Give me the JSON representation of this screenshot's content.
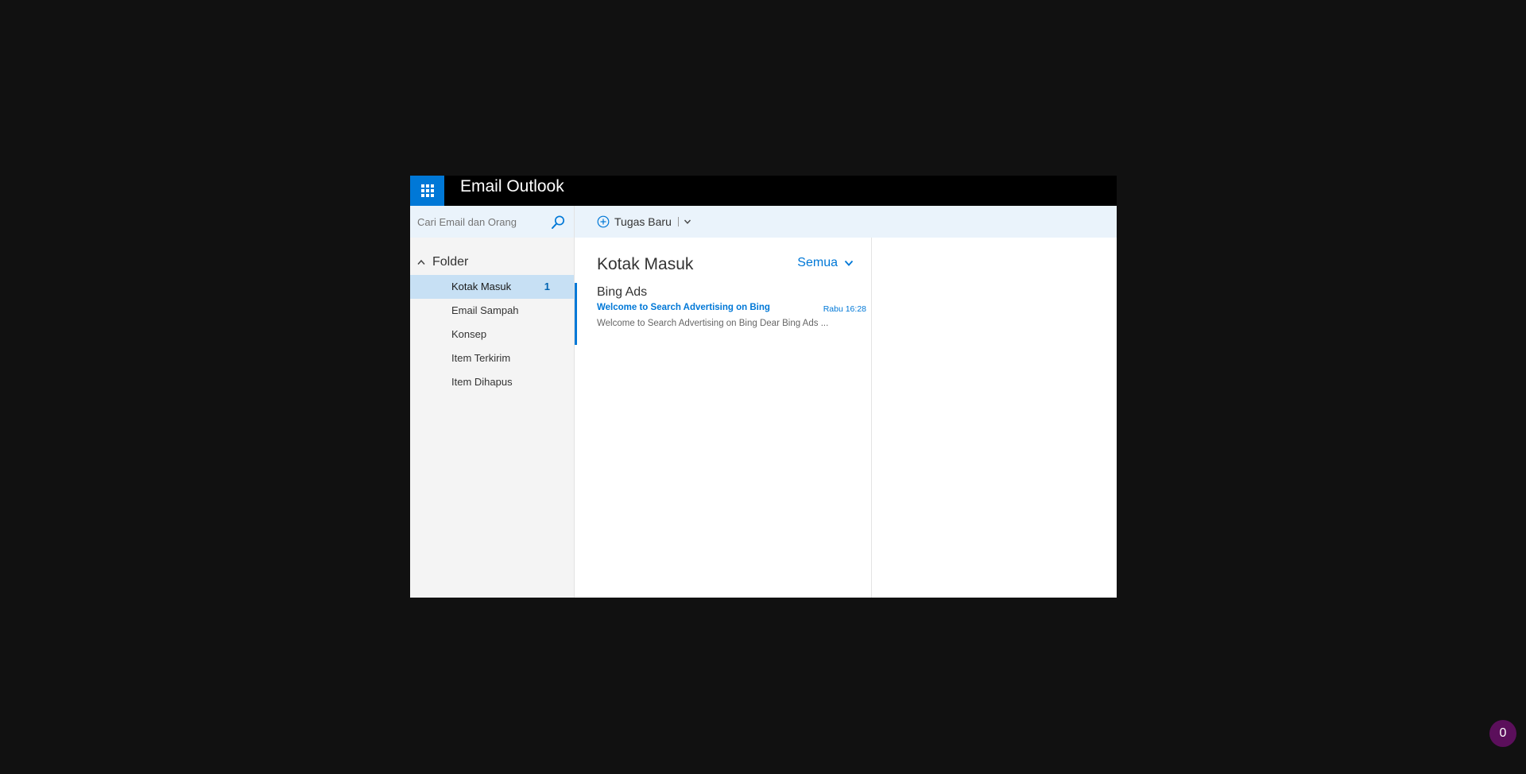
{
  "app": {
    "title": "Email Outlook"
  },
  "search": {
    "placeholder": "Cari Email dan Orang"
  },
  "sidebar": {
    "header": "Folder",
    "items": [
      {
        "label": "Kotak Masuk",
        "count": "1"
      },
      {
        "label": "Email Sampah"
      },
      {
        "label": "Konsep"
      },
      {
        "label": "Item Terkirim"
      },
      {
        "label": "Item Dihapus"
      }
    ]
  },
  "toolbar": {
    "new_task_label": "Tugas Baru"
  },
  "message_list": {
    "title": "Kotak Masuk",
    "filter": "Semua",
    "messages": [
      {
        "sender": "Bing Ads",
        "subject": "Welcome to Search Advertising on Bing",
        "time": "Rabu 16:28",
        "preview": "Welcome to Search Advertising on Bing   Dear Bing Ads ..."
      }
    ]
  },
  "badge": {
    "count": "0"
  },
  "colors": {
    "accent": "#0078d7",
    "selected_folder": "#c7e0f4",
    "toolbar_bg": "#eaf3fb",
    "topbar_bg": "#000000",
    "page_bg": "#111111",
    "badge_bg": "#5b0f5b"
  },
  "icons": {
    "app_launcher": "waffle-icon",
    "search": "search-icon",
    "folder_toggle": "chevron-up-icon",
    "new_task": "plus-circle-icon",
    "toolbar_dropdown": "chevron-down-icon",
    "filter_dropdown": "chevron-down-icon"
  }
}
